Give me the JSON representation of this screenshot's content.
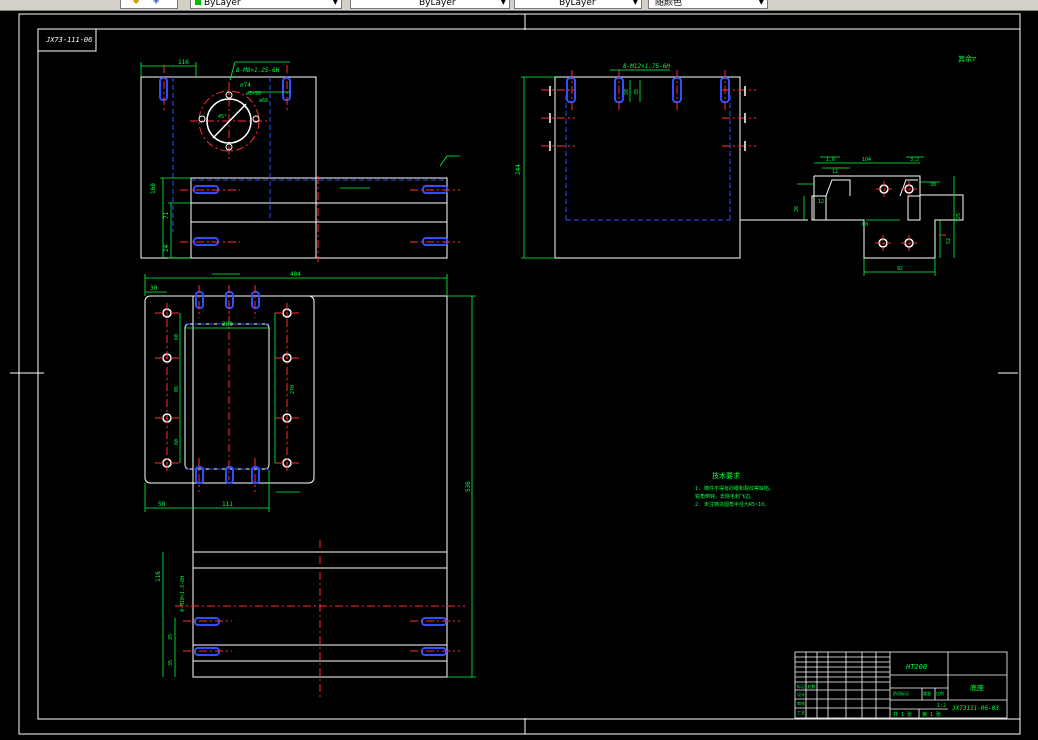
{
  "toolbar": {
    "layer_dropdown_1": "ByLayer",
    "layer_dropdown_2": "ByLayer",
    "layer_dropdown_3": "ByLayer",
    "color_dropdown": "随颜色"
  },
  "drawing": {
    "corner_code": "JX73-111-06",
    "front_view": {
      "dim_top": "116",
      "thread_note": "8-M8×1.25-6H",
      "hole_diam_1": "⌀74",
      "hole_diam_2": "⌀5×90",
      "angle_note": "45°",
      "pcd_note": "⌀66",
      "dim_height": "160",
      "dim_71": "71",
      "dim_24": "24"
    },
    "side_view": {
      "thread_note": "8-M12×1.75-6H",
      "dim_height": "244",
      "dim_20": "20",
      "dim_35": "35"
    },
    "detail_view": {
      "dim_104": "104",
      "dim_12": "12",
      "dim_60": "60",
      "dim_92": "92",
      "dim_125": "125",
      "dim_52": "52",
      "dim_38": "38",
      "dim_20": "20",
      "dim_12b": "12",
      "label_small_1": "1.6",
      "label_small_2": "3.2"
    },
    "top_view": {
      "dim_404": "404",
      "dim_30": "30",
      "dim_280": "280",
      "dim_60a": "60",
      "dim_86": "86",
      "dim_60b": "60",
      "dim_270": "270",
      "dim_111": "111",
      "dim_58": "58",
      "dim_536": "536",
      "dim_116": "116",
      "thread_side": "4-M10×1.5-6H",
      "dim_35a": "35",
      "dim_35b": "35"
    },
    "roughness": "其余",
    "tech_requirements": {
      "title": "技术要求",
      "line1": "1. 铸件不得有砂眼和裂纹等缺陷。",
      "line2": "   锐角倒钝，去除毛刺飞边。",
      "line3": "2. 未注铸造圆角半径为R5~10。"
    },
    "title_block": {
      "material": "HT200",
      "part_name": "底座",
      "drawing_no": "JX73111-06-03",
      "sheet_total": "共 1 张",
      "sheet_num": "第 1 张",
      "scale": "1:2",
      "row_label_1": "标记 处数",
      "row_label_2": "设计",
      "row_label_3": "审核",
      "row_label_4": "工艺",
      "row_label_5": "阶段标记",
      "row_label_6": "重量",
      "row_label_7": "比例"
    }
  }
}
